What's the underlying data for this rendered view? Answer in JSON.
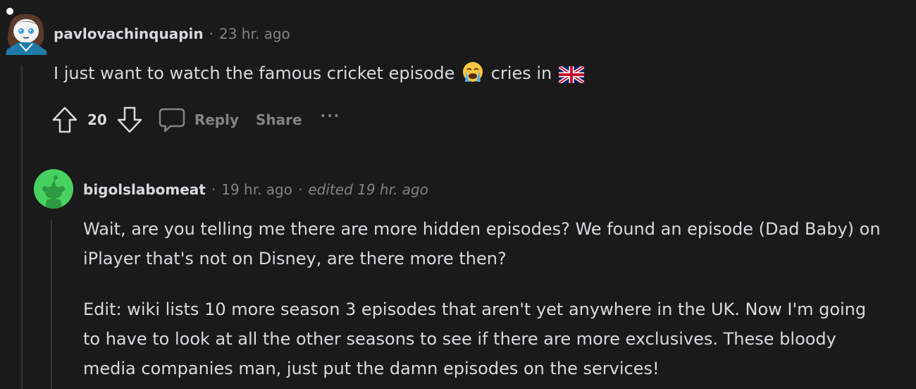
{
  "comment1": {
    "username": "pavlovachinquapin",
    "separator": "·",
    "time": "23 hr. ago",
    "text_before_emoji": "I just want to watch the famous cricket episode",
    "text_after_emoji": "cries in",
    "emoji_1": "loudly-crying-face-emoji",
    "emoji_2": "uk-flag-emoji",
    "score": "20",
    "reply_label": "Reply",
    "share_label": "Share",
    "more_label": "···"
  },
  "comment2": {
    "username": "bigolslabomeat",
    "separator": "·",
    "time": "19 hr. ago",
    "edited": "edited 19 hr. ago",
    "paragraph1": "Wait, are you telling me there are more hidden episodes? We found an episode (Dad Baby) on iPlayer that's not on Disney, are there more then?",
    "paragraph2": "Edit: wiki lists 10 more season 3 episodes that aren't yet anywhere in the UK. Now I'm going to have to look at all the other seasons to see if there are more exclusives. These bloody media companies man, just put the damn episodes on the services!"
  },
  "colors": {
    "background": "#1a1a1b",
    "text": "#d7dadc",
    "muted": "#818384",
    "thread_line": "#343536",
    "avatar_green": "#46d160"
  }
}
